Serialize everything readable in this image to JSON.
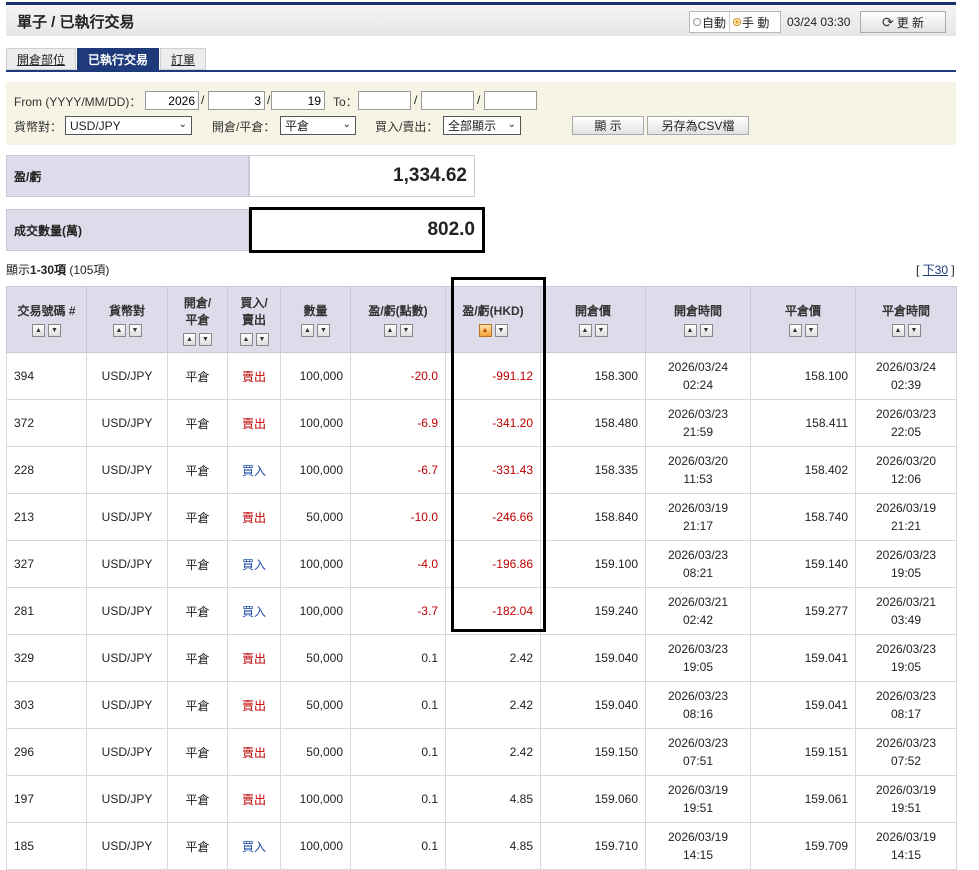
{
  "header": {
    "title": "單子 / 已執行交易",
    "mode_auto": "自動",
    "mode_manual": "手 動",
    "datetime": "03/24 03:30",
    "refresh_label": "更 新"
  },
  "tabs": [
    {
      "label": "開倉部位",
      "active": false
    },
    {
      "label": "已執行交易",
      "active": true
    },
    {
      "label": "訂單",
      "active": false
    }
  ],
  "filter": {
    "from_label": "From (YYYY/MM/DD)：",
    "from_year": "2026",
    "from_month": "3",
    "from_day": "19",
    "to_label": "To：",
    "to_year": "",
    "to_month": "",
    "to_day": "",
    "pair_label": "貨幣對：",
    "pair_value": "USD/JPY",
    "openclose_label": "開倉/平倉：",
    "openclose_value": "平倉",
    "buysell_label": "買入/賣出：",
    "buysell_value": "全部顯示",
    "show_button": "顯 示",
    "csv_button": "另存為CSV檔"
  },
  "summary": {
    "pl_label": "盈/虧",
    "pl_value": "1,334.62",
    "volume_label": "成交數量(萬)",
    "volume_value": "802.0"
  },
  "listing": {
    "prefix": "顯示",
    "range": "1-30項",
    "total": "(105項)",
    "next_open": "[ ",
    "next_link": "下30",
    "next_close": " ]"
  },
  "columns": [
    {
      "label": "交易號碼 #"
    },
    {
      "label": "貨幣對"
    },
    {
      "label": "開倉/\n平倉"
    },
    {
      "label": "買入/\n賣出"
    },
    {
      "label": "數量"
    },
    {
      "label": "盈/虧(點數)"
    },
    {
      "label": "盈/虧(HKD)"
    },
    {
      "label": "開倉價"
    },
    {
      "label": "開倉時間"
    },
    {
      "label": "平倉價"
    },
    {
      "label": "平倉時間"
    }
  ],
  "rows": [
    {
      "id": "394",
      "pair": "USD/JPY",
      "oc": "平倉",
      "side": "賣出",
      "qty": "100,000",
      "pips": "-20.0",
      "hkd": "-991.12",
      "open_price": "158.300",
      "open_date": "2026/03/24",
      "open_time": "02:24",
      "close_price": "158.100",
      "close_date": "2026/03/24",
      "close_time": "02:39"
    },
    {
      "id": "372",
      "pair": "USD/JPY",
      "oc": "平倉",
      "side": "賣出",
      "qty": "100,000",
      "pips": "-6.9",
      "hkd": "-341.20",
      "open_price": "158.480",
      "open_date": "2026/03/23",
      "open_time": "21:59",
      "close_price": "158.411",
      "close_date": "2026/03/23",
      "close_time": "22:05"
    },
    {
      "id": "228",
      "pair": "USD/JPY",
      "oc": "平倉",
      "side": "買入",
      "qty": "100,000",
      "pips": "-6.7",
      "hkd": "-331.43",
      "open_price": "158.335",
      "open_date": "2026/03/20",
      "open_time": "11:53",
      "close_price": "158.402",
      "close_date": "2026/03/20",
      "close_time": "12:06"
    },
    {
      "id": "213",
      "pair": "USD/JPY",
      "oc": "平倉",
      "side": "賣出",
      "qty": "50,000",
      "pips": "-10.0",
      "hkd": "-246.66",
      "open_price": "158.840",
      "open_date": "2026/03/19",
      "open_time": "21:17",
      "close_price": "158.740",
      "close_date": "2026/03/19",
      "close_time": "21:21"
    },
    {
      "id": "327",
      "pair": "USD/JPY",
      "oc": "平倉",
      "side": "買入",
      "qty": "100,000",
      "pips": "-4.0",
      "hkd": "-196.86",
      "open_price": "159.100",
      "open_date": "2026/03/23",
      "open_time": "08:21",
      "close_price": "159.140",
      "close_date": "2026/03/23",
      "close_time": "19:05"
    },
    {
      "id": "281",
      "pair": "USD/JPY",
      "oc": "平倉",
      "side": "買入",
      "qty": "100,000",
      "pips": "-3.7",
      "hkd": "-182.04",
      "open_price": "159.240",
      "open_date": "2026/03/21",
      "open_time": "02:42",
      "close_price": "159.277",
      "close_date": "2026/03/21",
      "close_time": "03:49"
    },
    {
      "id": "329",
      "pair": "USD/JPY",
      "oc": "平倉",
      "side": "賣出",
      "qty": "50,000",
      "pips": "0.1",
      "hkd": "2.42",
      "open_price": "159.040",
      "open_date": "2026/03/23",
      "open_time": "19:05",
      "close_price": "159.041",
      "close_date": "2026/03/23",
      "close_time": "19:05"
    },
    {
      "id": "303",
      "pair": "USD/JPY",
      "oc": "平倉",
      "side": "賣出",
      "qty": "50,000",
      "pips": "0.1",
      "hkd": "2.42",
      "open_price": "159.040",
      "open_date": "2026/03/23",
      "open_time": "08:16",
      "close_price": "159.041",
      "close_date": "2026/03/23",
      "close_time": "08:17"
    },
    {
      "id": "296",
      "pair": "USD/JPY",
      "oc": "平倉",
      "side": "賣出",
      "qty": "50,000",
      "pips": "0.1",
      "hkd": "2.42",
      "open_price": "159.150",
      "open_date": "2026/03/23",
      "open_time": "07:51",
      "close_price": "159.151",
      "close_date": "2026/03/23",
      "close_time": "07:52"
    },
    {
      "id": "197",
      "pair": "USD/JPY",
      "oc": "平倉",
      "side": "賣出",
      "qty": "100,000",
      "pips": "0.1",
      "hkd": "4.85",
      "open_price": "159.060",
      "open_date": "2026/03/19",
      "open_time": "19:51",
      "close_price": "159.061",
      "close_date": "2026/03/19",
      "close_time": "19:51"
    },
    {
      "id": "185",
      "pair": "USD/JPY",
      "oc": "平倉",
      "side": "買入",
      "qty": "100,000",
      "pips": "0.1",
      "hkd": "4.85",
      "open_price": "159.710",
      "open_date": "2026/03/19",
      "open_time": "14:15",
      "close_price": "159.709",
      "close_date": "2026/03/19",
      "close_time": "14:15"
    }
  ]
}
